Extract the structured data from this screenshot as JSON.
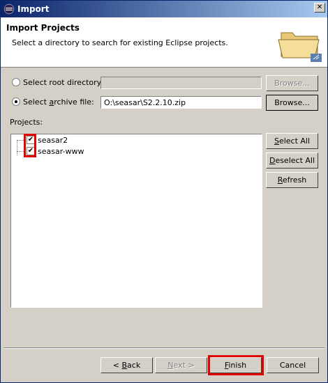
{
  "window": {
    "title": "Import"
  },
  "header": {
    "heading": "Import Projects",
    "description": "Select a directory to search for existing Eclipse projects."
  },
  "source": {
    "root_directory_label": "Select root directory:",
    "root_directory_value": "",
    "root_selected": false,
    "archive_file_label": "Select archive file:",
    "archive_file_value": "O:\\seasar\\S2.2.10.zip",
    "archive_selected": true,
    "browse_label": "Browse..."
  },
  "projects": {
    "label": "Projects:",
    "items": [
      {
        "label": "seasar2",
        "checked": true
      },
      {
        "label": "seasar-www",
        "checked": true
      }
    ]
  },
  "side_buttons": {
    "select_all": "Select All",
    "deselect_all": "Deselect All",
    "refresh": "Refresh"
  },
  "footer": {
    "back": "< Back",
    "next": "Next >",
    "finish": "Finish",
    "cancel": "Cancel"
  },
  "colors": {
    "highlight": "#e00000",
    "titlebar": "#0a246a"
  }
}
